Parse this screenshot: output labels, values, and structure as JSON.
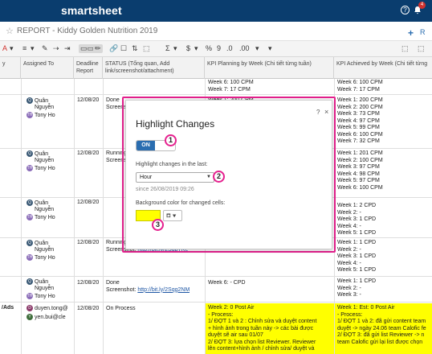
{
  "app": {
    "brand": "smartsheet",
    "help_icon": "?",
    "notification_count": "4"
  },
  "sheet": {
    "title": "REPORT - Kiddy Golden Nutrition 2019",
    "collab_label": "R"
  },
  "toolbar": {
    "items": [
      "A",
      "▾",
      "≡",
      "▾",
      "✎",
      "⇢",
      "⇥",
      "✏",
      "🔗",
      "☐",
      "⇅",
      "⬚",
      "Σ",
      "▾",
      "$",
      "▾",
      "%",
      "9",
      ".0",
      ".00",
      "▾",
      "▾",
      "⬚",
      "⬚"
    ]
  },
  "columns": [
    {
      "label": "y"
    },
    {
      "label": "Assigned To"
    },
    {
      "label": "Deadline Report"
    },
    {
      "label": "STATUS (Tổng quan, Add link/screenshot/attachment)"
    },
    {
      "label": "KPI Planning by Week (Chi tiết từng tuần)"
    },
    {
      "label": "KPI Achieved by Week (Chi tiết từng"
    }
  ],
  "rows": [
    {
      "assignees": [],
      "deadline": "",
      "status": "",
      "planning": [
        "Week 6: 100 CPM",
        "Week 7: 17 CPM"
      ],
      "achieved": [
        "Week 6: 100 CPM",
        "Week 7: 17 CPM"
      ]
    },
    {
      "assignees": [
        {
          "initials": "Q",
          "name": "Quân"
        },
        {
          "initials": "",
          "name": "Nguyễn"
        },
        {
          "initials": "TH",
          "name": "Tony Ho"
        }
      ],
      "deadline": "12/08/20",
      "status": "Done Screensh",
      "planning": [
        "Week 1: 200 CPM"
      ],
      "achieved": [
        "Week 1: 200 CPM",
        "Week 2: 200 CPM",
        "Week 3: 73 CPM",
        "Week 4: 97 CPM",
        "Week 5: 99 CPM",
        "Week 6: 100 CPM",
        "Week 7: 32 CPM"
      ]
    },
    {
      "assignees": [
        {
          "initials": "Q",
          "name": "Quân"
        },
        {
          "initials": "",
          "name": "Nguyễn"
        },
        {
          "initials": "TH",
          "name": "Tony Ho"
        }
      ],
      "deadline": "12/08/20",
      "status": "Running Screensh",
      "planning": [],
      "achieved": [
        "Week 1: 201 CPM",
        "Week 2: 100 CPM",
        "Week 3: 97 CPM",
        "Week 4: 98 CPM",
        "Week 5: 97 CPM",
        "Week 6: 100 CPM"
      ]
    },
    {
      "assignees": [
        {
          "initials": "Q",
          "name": "Quân"
        },
        {
          "initials": "",
          "name": "Nguyễn"
        },
        {
          "initials": "TH",
          "name": "Tony Ho"
        }
      ],
      "deadline": "12/08/20",
      "status": "",
      "planning": [],
      "achieved": [
        "Week 1: 2 CPD",
        "Week 2: -",
        "Week 3: 1 CPD",
        "Week 4: -",
        "Week 5: 1 CPD"
      ]
    },
    {
      "assignees": [
        {
          "initials": "Q",
          "name": "Quân"
        },
        {
          "initials": "",
          "name": "Nguyễn"
        },
        {
          "initials": "TH",
          "name": "Tony Ho"
        }
      ],
      "deadline": "12/08/20",
      "status": "Running",
      "status_link_prefix": "Screenshot: ",
      "status_link": "http://bit.ly/2SqpTKe",
      "planning": [],
      "achieved": [
        "Week 1: 1 CPD",
        "Week 2: -",
        "Week 3: 1 CPD",
        "Week 4: -",
        "Week 5: 1 CPD"
      ]
    },
    {
      "assignees": [
        {
          "initials": "Q",
          "name": "Quân"
        },
        {
          "initials": "",
          "name": "Nguyễn"
        },
        {
          "initials": "TH",
          "name": "Tony Ho"
        }
      ],
      "deadline": "12/08/20",
      "status": "Done",
      "status_link_prefix": "Screenshot: ",
      "status_link": "http://bit.ly/2Sqg2NM",
      "planning": [
        "Week 6: - CPD"
      ],
      "achieved": [
        "Week 1: 1 CPD",
        "Week 2: -",
        "Week 3: -",
        "Week 4: -",
        "Week 5: -"
      ]
    },
    {
      "label": "/Ads",
      "assignees": [
        {
          "initials": "D",
          "name": "duyen.tong@"
        },
        {
          "initials": "Y",
          "name": "yen.bui@cle"
        }
      ],
      "deadline": "12/08/20",
      "status": "On Process",
      "planning": [
        "Week 2: 0 Post Air",
        "- Process:",
        "1/ ĐỢT 1 và 2 : Chỉnh sửa và duyệt content",
        "+ hình ảnh trong tuần này -> các bài được",
        "duyệt sẽ air sau 01/07",
        "2/ ĐỢT 3: lựa chọn list Reviewer. Reviewer",
        "lên content+hình ảnh / chỉnh sửa/ duyệt và"
      ],
      "achieved": [
        "Week 1: Est: 0 Post Air",
        "- Process:",
        "1/ ĐỢT 1 và 2: đã gửi content team",
        "duyệt -> ngày 24.06 team Calofic fe",
        "2/ ĐỢT 3: đã gửi list Reviewer -> n",
        "team Calofic gửi lại list được chọn"
      ]
    }
  ],
  "modal": {
    "title": "Highlight Changes",
    "help": "?",
    "close": "×",
    "toggle_label": "ON",
    "last_label": "Highlight changes in the last:",
    "period_value": "Hour",
    "since_text": "since 26/08/2019 09:26",
    "bg_label": "Background color for changed cells:",
    "color": "#ffff00"
  },
  "callouts": [
    "1",
    "2",
    "3"
  ],
  "icons": {
    "star": "star-icon",
    "help": "help-icon",
    "bell": "bell-icon",
    "fill": "paint-bucket-icon",
    "caret": "chevron-down-icon",
    "close": "close-icon"
  }
}
